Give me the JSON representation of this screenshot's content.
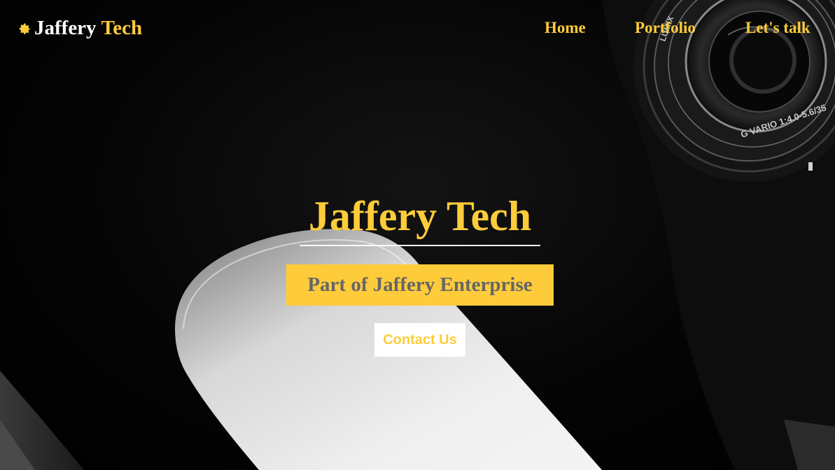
{
  "brand": {
    "icon": "gear-icon",
    "first": "Jaffery",
    "second": "Tech"
  },
  "nav": {
    "items": [
      {
        "label": "Home"
      },
      {
        "label": "Portfolio"
      },
      {
        "label": "Let's talk"
      }
    ]
  },
  "hero": {
    "title": "Jaffery Tech",
    "subtitle": "Part of Jaffery Enterprise",
    "cta_label": "Contact Us",
    "background_photo": {
      "lens_text": "G VARIO 1:4.0-5.6/35",
      "lens_brand": "LUMIX"
    }
  },
  "colors": {
    "accent": "#fecc3a",
    "background": "#000000",
    "subtitle_text": "#666666",
    "white": "#ffffff"
  }
}
